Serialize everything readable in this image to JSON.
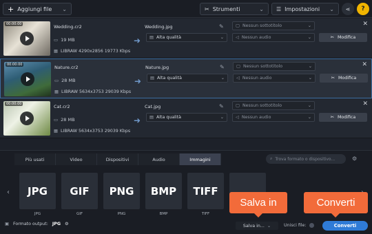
{
  "toolbar": {
    "add_files": "Aggiungi file",
    "tools": "Strumenti",
    "settings": "Impostazioni"
  },
  "files": [
    {
      "duration": "00:00:00",
      "name": "Wedding.cr2",
      "size": "19 MB",
      "info": "LIBRAW 4290x2856 19773 Kbps",
      "output_name": "Wedding.jpg",
      "quality": "Alta qualità",
      "subtitle": "Nessun sottotitolo",
      "audio": "Nessun audio",
      "edit": "Modifica",
      "selected": false
    },
    {
      "duration": "00:00:00",
      "name": "Nature.cr2",
      "size": "28 MB",
      "info": "LIBRAW 5634x3753 29039 Kbps",
      "output_name": "Nature.jpg",
      "quality": "Alta qualità",
      "subtitle": "Nessun sottotitolo",
      "audio": "Nessun audio",
      "edit": "Modifica",
      "selected": true
    },
    {
      "duration": "00:00:00",
      "name": "Cat.cr2",
      "size": "28 MB",
      "info": "LIBRAW 5634x3753 29039 Kbps",
      "output_name": "Cat.jpg",
      "quality": "Alta qualità",
      "subtitle": "Nessun sottotitolo",
      "audio": "Nessun audio",
      "edit": "Modifica",
      "selected": false
    }
  ],
  "tabs": [
    "Più usati",
    "Video",
    "Dispositivi",
    "Audio",
    "Immagini"
  ],
  "active_tab": "Immagini",
  "search_placeholder": "Trova formato o dispositivo...",
  "formats": [
    {
      "label": "JPG",
      "caption": "JPG"
    },
    {
      "label": "GIF",
      "caption": "GIF"
    },
    {
      "label": "PNG",
      "caption": "PNG"
    },
    {
      "label": "BMP",
      "caption": "BMP"
    },
    {
      "label": "TIFF",
      "caption": "TIFF"
    },
    {
      "label": "",
      "caption": ""
    }
  ],
  "bottom": {
    "output_format_label": "Formato output:",
    "output_format_value": "JPG",
    "save_label": "Salva in...",
    "merge_label": "Unisci file:",
    "convert_label": "Converti"
  },
  "callouts": {
    "save": "Salva in",
    "convert": "Converti"
  },
  "colors": {
    "accent": "#2f7bd7",
    "callout": "#f26b3a",
    "selected_border": "#3c6da0"
  }
}
